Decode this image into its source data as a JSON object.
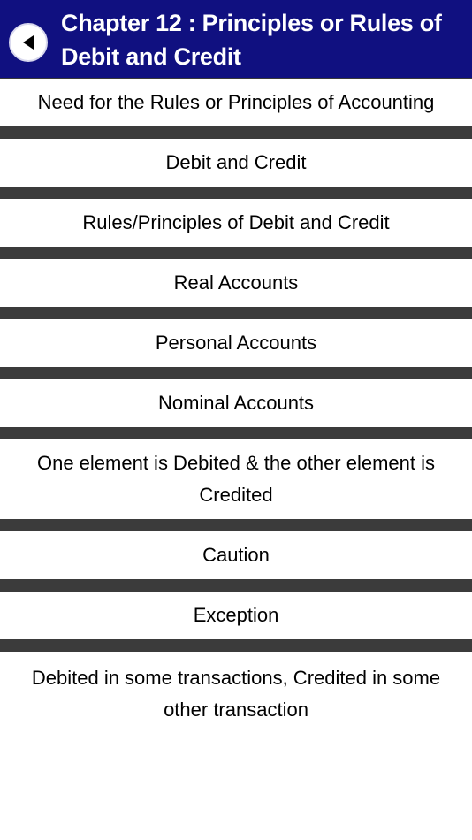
{
  "header": {
    "title": "Chapter 12 : Principles or Rules of Debit and Credit",
    "back_icon": "back-arrow-icon"
  },
  "topics": [
    "Need for the Rules or Principles of Accounting",
    "Debit and Credit",
    "Rules/Principles of Debit and Credit",
    "Real Accounts",
    "Personal Accounts",
    "Nominal Accounts",
    "One element is Debited & the other element is Credited",
    "Caution",
    "Exception",
    "Debited in some transactions, Credited in some other transaction"
  ],
  "colors": {
    "header_bg": "#101080",
    "separator": "#3b3b3b",
    "item_bg": "#ffffff"
  }
}
